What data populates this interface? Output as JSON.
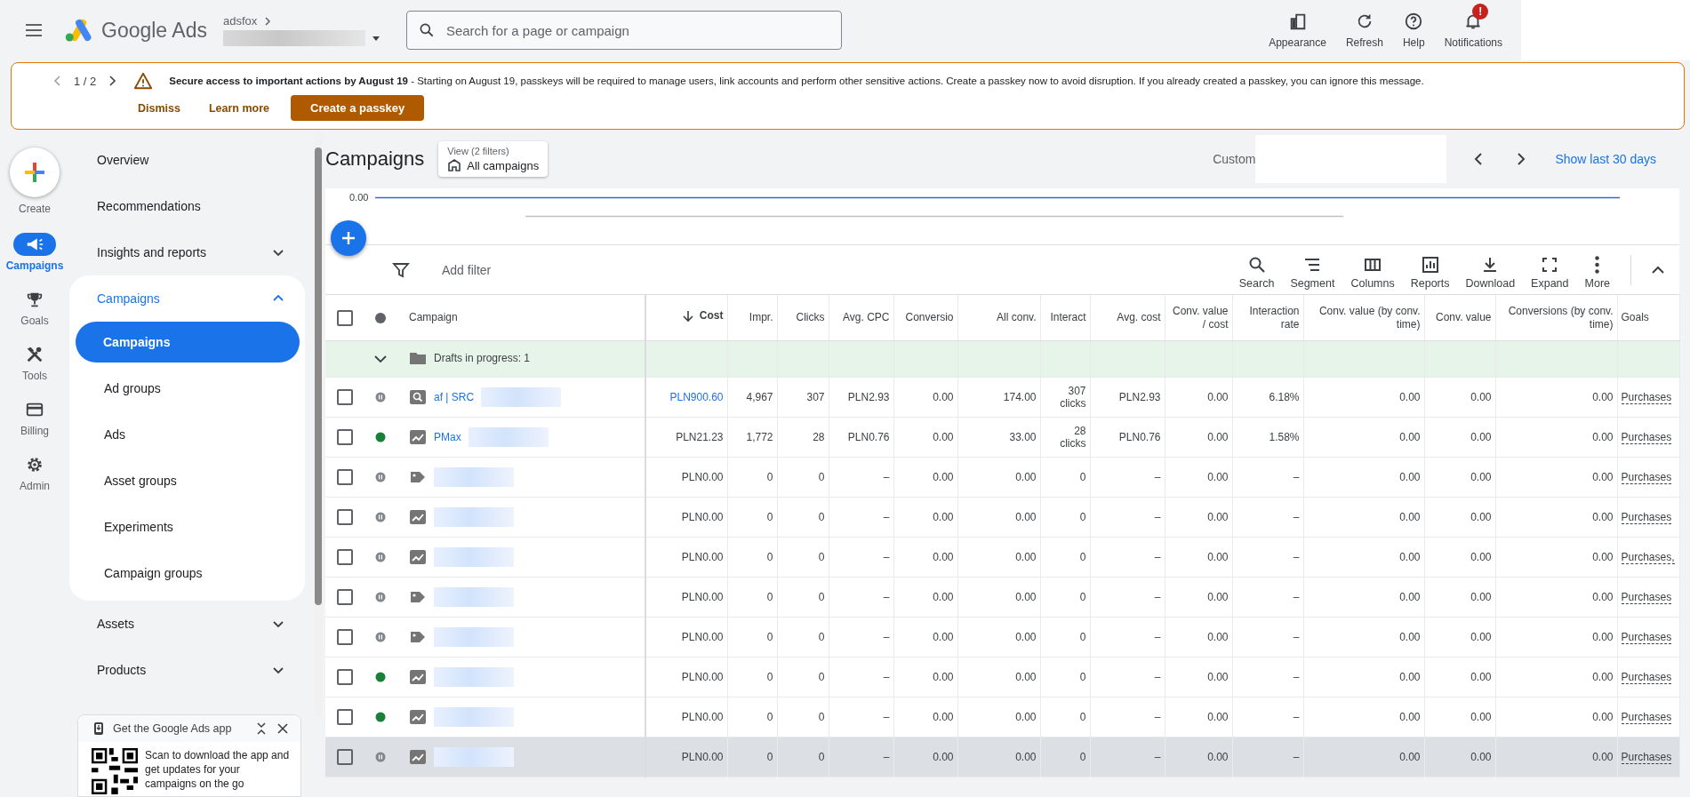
{
  "topbar": {
    "product": "Google Ads",
    "account": "adsfox",
    "search": {
      "placeholder": "Search for a page or campaign"
    },
    "actions": [
      {
        "label": "Appearance"
      },
      {
        "label": "Refresh"
      },
      {
        "label": "Help"
      },
      {
        "label": "Notifications",
        "badge": "!"
      }
    ]
  },
  "banner": {
    "pager": "1 / 2",
    "title": "Secure access to important actions by August 19",
    "message": " - Starting on August 19, passkeys will be required to manage users, link accounts and perform other sensitive actions. Create a passkey now to avoid disruption. If you already created a passkey, you can ignore this message.",
    "buttons": [
      {
        "label": "Dismiss",
        "kind": "text"
      },
      {
        "label": "Learn more",
        "kind": "text"
      },
      {
        "label": "Create a passkey",
        "kind": "filled"
      }
    ]
  },
  "create": {
    "label": "Create"
  },
  "rail": [
    {
      "label": "Campaigns",
      "selected": true
    },
    {
      "label": "Goals",
      "selected": false
    },
    {
      "label": "Tools",
      "selected": false
    },
    {
      "label": "Billing",
      "selected": false
    },
    {
      "label": "Admin",
      "selected": false
    }
  ],
  "nav": [
    {
      "label": "Overview"
    },
    {
      "label": "Recommendations"
    },
    {
      "label": "Insights and reports",
      "expanded": false
    },
    {
      "label": "Campaigns",
      "expanded": true,
      "children": [
        {
          "label": "Campaigns",
          "selected": true
        },
        {
          "label": "Ad groups",
          "selected": false
        },
        {
          "label": "Ads",
          "selected": false
        },
        {
          "label": "Asset groups",
          "selected": false
        },
        {
          "label": "Experiments",
          "selected": false
        },
        {
          "label": "Campaign groups",
          "selected": false
        }
      ]
    },
    {
      "label": "Assets",
      "expanded": false
    },
    {
      "label": "Products",
      "expanded": false
    }
  ],
  "app_promo": {
    "title": "Get the Google Ads app",
    "text": "Scan to download the app and get updates for your campaigns on the go"
  },
  "page": {
    "title": "Campaigns",
    "view_caption": "View (2 filters)",
    "view": "All campaigns",
    "date_caption": "Custom",
    "date_link": "Show last 30 days"
  },
  "chart": {
    "axis_label": "0.00"
  },
  "toolbar": {
    "filter": "Add filter",
    "tools": [
      {
        "label": "Search"
      },
      {
        "label": "Segment"
      },
      {
        "label": "Columns"
      },
      {
        "label": "Reports"
      },
      {
        "label": "Download"
      },
      {
        "label": "Expand"
      },
      {
        "label": "More"
      }
    ]
  },
  "table": {
    "campaign_header": "Campaign",
    "columns": [
      {
        "label": "Cost",
        "sorted": true
      },
      {
        "label": "Impr.",
        "sorted": false
      },
      {
        "label": "Clicks",
        "sorted": false
      },
      {
        "label": "Avg. CPC",
        "sorted": false
      },
      {
        "label": "Conversio",
        "sorted": false
      },
      {
        "label": "All conv.",
        "sorted": false
      },
      {
        "label": "Interact",
        "sorted": false
      },
      {
        "label": "Avg. cost",
        "sorted": false
      },
      {
        "label": "Conv. value / cost",
        "sorted": false
      },
      {
        "label": "Interaction rate",
        "sorted": false
      },
      {
        "label": "Conv. value (by conv. time)",
        "sorted": false
      },
      {
        "label": "Conv. value",
        "sorted": false
      },
      {
        "label": "Conversions (by conv. time)",
        "sorted": false
      },
      {
        "label": "Goals",
        "sorted": false
      }
    ],
    "select_all_checked": false,
    "drafts": {
      "label": "Drafts in progress: 1",
      "expanded": true
    },
    "rows": [
      {
        "checked": false,
        "enabled": false,
        "kind": "search",
        "name": "af | SRC",
        "cost_link": true,
        "hovered": false,
        "cells": [
          "PLN900.60",
          "4,967",
          "307",
          "PLN2.93",
          "0.00",
          "174.00",
          "307 clicks",
          "PLN2.93",
          "0.00",
          "6.18%",
          "0.00",
          "0.00",
          "0.00"
        ],
        "goal": "Purchases"
      },
      {
        "checked": false,
        "enabled": true,
        "kind": "pmax",
        "name": "PMax",
        "cost_link": false,
        "hovered": false,
        "cells": [
          "PLN21.23",
          "1,772",
          "28",
          "PLN0.76",
          "0.00",
          "33.00",
          "28 clicks",
          "PLN0.76",
          "0.00",
          "1.58%",
          "0.00",
          "0.00",
          "0.00"
        ],
        "goal": "Purchases"
      },
      {
        "checked": false,
        "enabled": false,
        "kind": "shopping",
        "cost_link": false,
        "hovered": false,
        "cells": [
          "PLN0.00",
          "0",
          "0",
          "–",
          "0.00",
          "0.00",
          "0",
          "–",
          "0.00",
          "–",
          "0.00",
          "0.00",
          "0.00"
        ],
        "goal": "Purchases"
      },
      {
        "checked": false,
        "enabled": false,
        "kind": "pmax",
        "cost_link": false,
        "hovered": false,
        "cells": [
          "PLN0.00",
          "0",
          "0",
          "–",
          "0.00",
          "0.00",
          "0",
          "–",
          "0.00",
          "–",
          "0.00",
          "0.00",
          "0.00"
        ],
        "goal": "Purchases"
      },
      {
        "checked": false,
        "enabled": false,
        "kind": "pmax",
        "cost_link": false,
        "hovered": false,
        "cells": [
          "PLN0.00",
          "0",
          "0",
          "–",
          "0.00",
          "0.00",
          "0",
          "–",
          "0.00",
          "–",
          "0.00",
          "0.00",
          "0.00"
        ],
        "goal": "Purchases,"
      },
      {
        "checked": false,
        "enabled": false,
        "kind": "shopping",
        "cost_link": false,
        "hovered": false,
        "cells": [
          "PLN0.00",
          "0",
          "0",
          "–",
          "0.00",
          "0.00",
          "0",
          "–",
          "0.00",
          "–",
          "0.00",
          "0.00",
          "0.00"
        ],
        "goal": "Purchases"
      },
      {
        "checked": false,
        "enabled": false,
        "kind": "shopping",
        "cost_link": false,
        "hovered": false,
        "cells": [
          "PLN0.00",
          "0",
          "0",
          "–",
          "0.00",
          "0.00",
          "0",
          "–",
          "0.00",
          "–",
          "0.00",
          "0.00",
          "0.00"
        ],
        "goal": "Purchases"
      },
      {
        "checked": false,
        "enabled": true,
        "kind": "pmax",
        "cost_link": false,
        "hovered": false,
        "cells": [
          "PLN0.00",
          "0",
          "0",
          "–",
          "0.00",
          "0.00",
          "0",
          "–",
          "0.00",
          "–",
          "0.00",
          "0.00",
          "0.00"
        ],
        "goal": "Purchases"
      },
      {
        "checked": false,
        "enabled": true,
        "kind": "pmax",
        "cost_link": false,
        "hovered": false,
        "cells": [
          "PLN0.00",
          "0",
          "0",
          "–",
          "0.00",
          "0.00",
          "0",
          "–",
          "0.00",
          "–",
          "0.00",
          "0.00",
          "0.00"
        ],
        "goal": "Purchases"
      },
      {
        "checked": false,
        "enabled": false,
        "kind": "pmax",
        "cost_link": false,
        "hovered": true,
        "cells": [
          "PLN0.00",
          "0",
          "0",
          "–",
          "0.00",
          "0.00",
          "0",
          "–",
          "0.00",
          "–",
          "0.00",
          "0.00",
          "0.00"
        ],
        "goal": "Purchases"
      }
    ]
  }
}
